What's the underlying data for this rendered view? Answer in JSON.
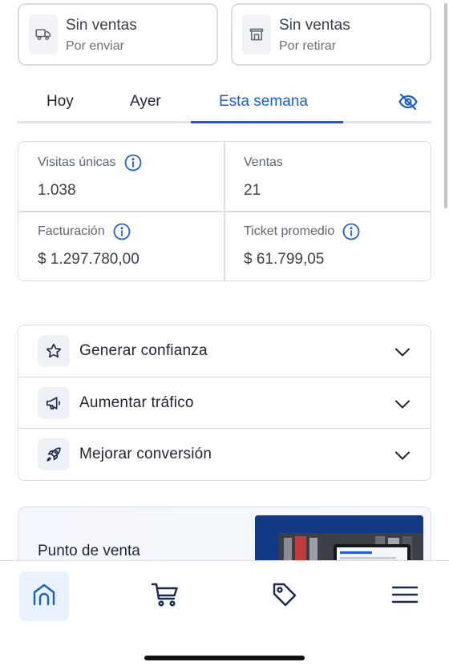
{
  "summary_cards": [
    {
      "title": "Sin ventas",
      "subtitle": "Por enviar",
      "icon": "truck-icon"
    },
    {
      "title": "Sin ventas",
      "subtitle": "Por retirar",
      "icon": "store-icon"
    }
  ],
  "tabs": {
    "items": [
      {
        "label": "Hoy"
      },
      {
        "label": "Ayer"
      },
      {
        "label": "Esta semana",
        "active": true
      }
    ],
    "visibility_icon": "eye-off-icon"
  },
  "stats": [
    {
      "label": "Visitas únicas",
      "value": "1.038",
      "info": true
    },
    {
      "label": "Ventas",
      "value": "21",
      "info": false
    },
    {
      "label": "Facturación",
      "value": "$ 1.297.780,00",
      "info": true
    },
    {
      "label": "Ticket promedio",
      "value": "$ 61.799,05",
      "info": true
    }
  ],
  "accordion": [
    {
      "label": "Generar confianza",
      "icon": "star-icon"
    },
    {
      "label": "Aumentar tráfico",
      "icon": "megaphone-icon"
    },
    {
      "label": "Mejorar conversión",
      "icon": "rocket-icon"
    }
  ],
  "promo": {
    "title": "Punto de venta"
  },
  "bottom_nav": [
    {
      "icon": "home-icon",
      "active": true
    },
    {
      "icon": "cart-icon"
    },
    {
      "icon": "tag-icon"
    },
    {
      "icon": "menu-icon"
    }
  ],
  "colors": {
    "accent": "#1f5fc4",
    "border": "#d9dce3",
    "text": "#1f2430",
    "muted": "#5f646e",
    "icon_dark": "#1b2a4a"
  }
}
